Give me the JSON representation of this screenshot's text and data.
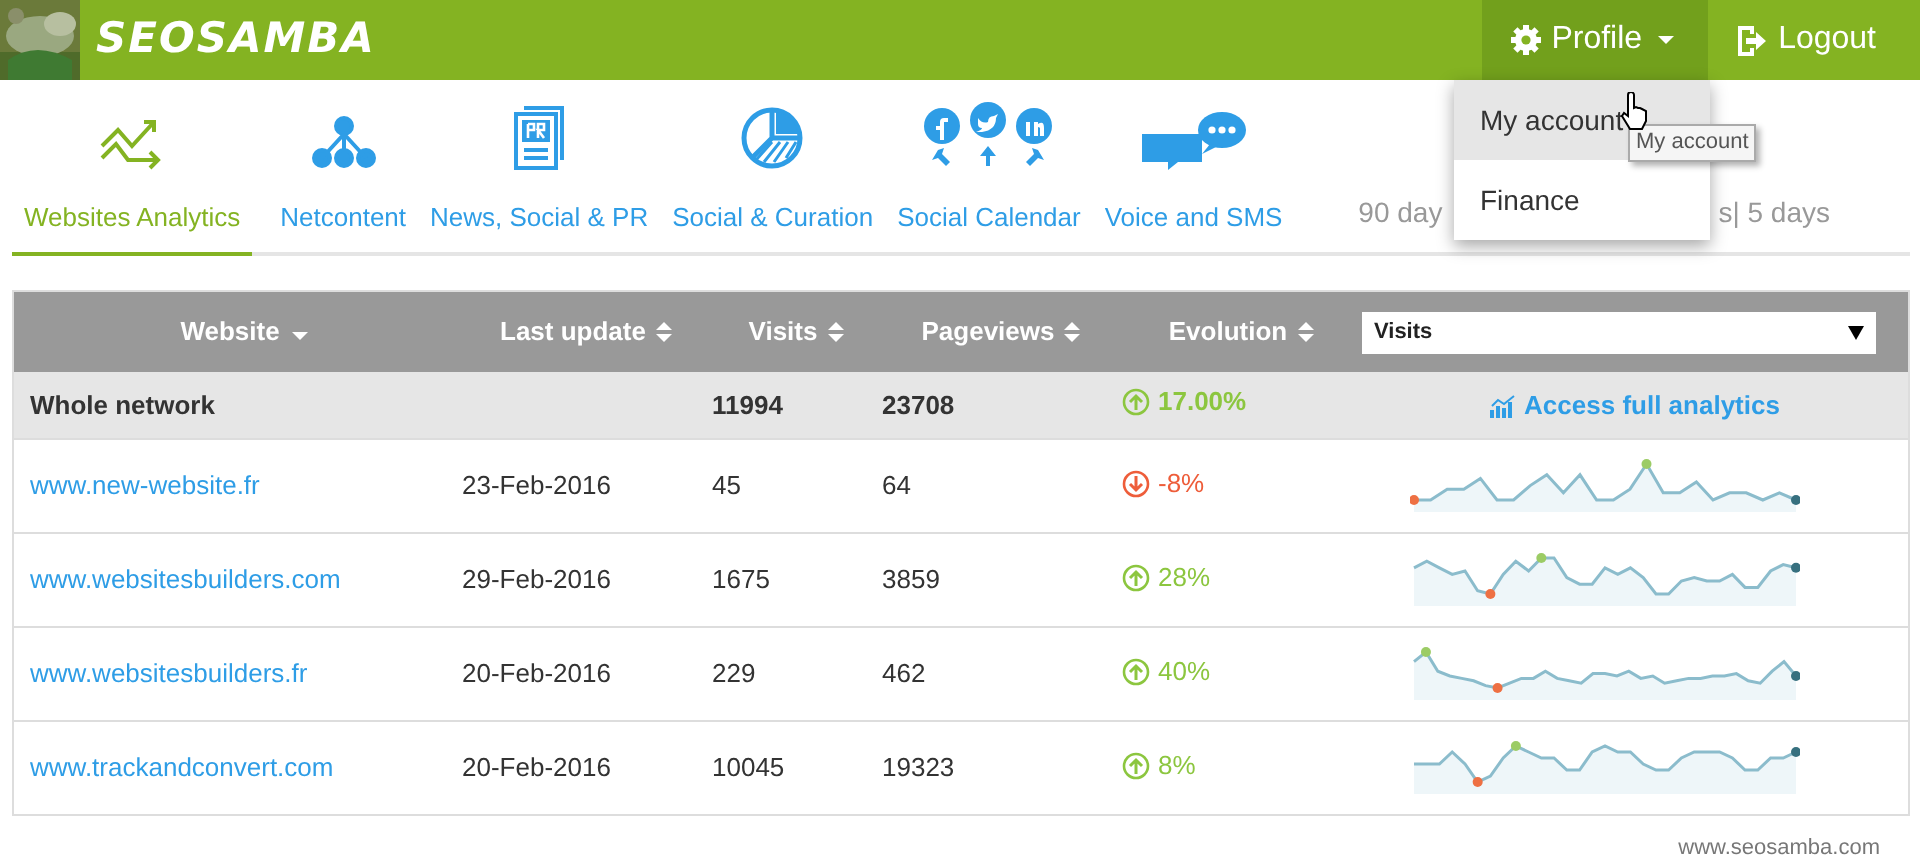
{
  "brand": {
    "logo_text": "SEOSAMBA"
  },
  "profile": {
    "label": "Profile",
    "expanded": true,
    "menu": [
      {
        "label": "My account",
        "selected": true
      },
      {
        "label": "Finance",
        "selected": false
      }
    ],
    "tooltip": "My account"
  },
  "logout": {
    "label": "Logout"
  },
  "tabs": [
    {
      "label": "Websites Analytics",
      "kind": "analytics",
      "selected": true
    },
    {
      "label": "Netcontent",
      "kind": "network",
      "selected": false
    },
    {
      "label": "News, Social & PR",
      "kind": "pr",
      "selected": false
    },
    {
      "label": "Social & Curation",
      "kind": "pie",
      "selected": false
    },
    {
      "label": "Social Calendar",
      "kind": "social",
      "selected": false
    },
    {
      "label": "Voice and SMS",
      "kind": "sms",
      "selected": false
    }
  ],
  "period": {
    "left": "90 day",
    "right": "s| 5 days"
  },
  "table": {
    "columns": [
      {
        "label": "Website",
        "sorted": true
      },
      {
        "label": "Last update",
        "sorted": false
      },
      {
        "label": "Visits",
        "sorted": false
      },
      {
        "label": "Pageviews",
        "sorted": false
      },
      {
        "label": "Evolution",
        "sorted": false
      }
    ],
    "metric_select": {
      "value": "Visits"
    },
    "summary": {
      "label": "Whole network",
      "visits": "11994",
      "pageviews": "23708",
      "evolution": "17.00%",
      "rising": true,
      "link": "Access full analytics"
    },
    "rows": [
      {
        "website": "www.new-website.fr",
        "last_update": "23-Feb-2016",
        "visits": "45",
        "pageviews": "64",
        "evolution": "-8%",
        "rising": false
      },
      {
        "website": "www.websitesbuilders.com",
        "last_update": "29-Feb-2016",
        "visits": "1675",
        "pageviews": "3859",
        "evolution": "28%",
        "rising": true
      },
      {
        "website": "www.websitesbuilders.fr",
        "last_update": "20-Feb-2016",
        "visits": "229",
        "pageviews": "462",
        "evolution": "40%",
        "rising": true
      },
      {
        "website": "www.trackandconvert.com",
        "last_update": "20-Feb-2016",
        "visits": "10045",
        "pageviews": "19323",
        "evolution": "8%",
        "rising": true
      }
    ]
  },
  "footer": "www.seosamba.com"
}
